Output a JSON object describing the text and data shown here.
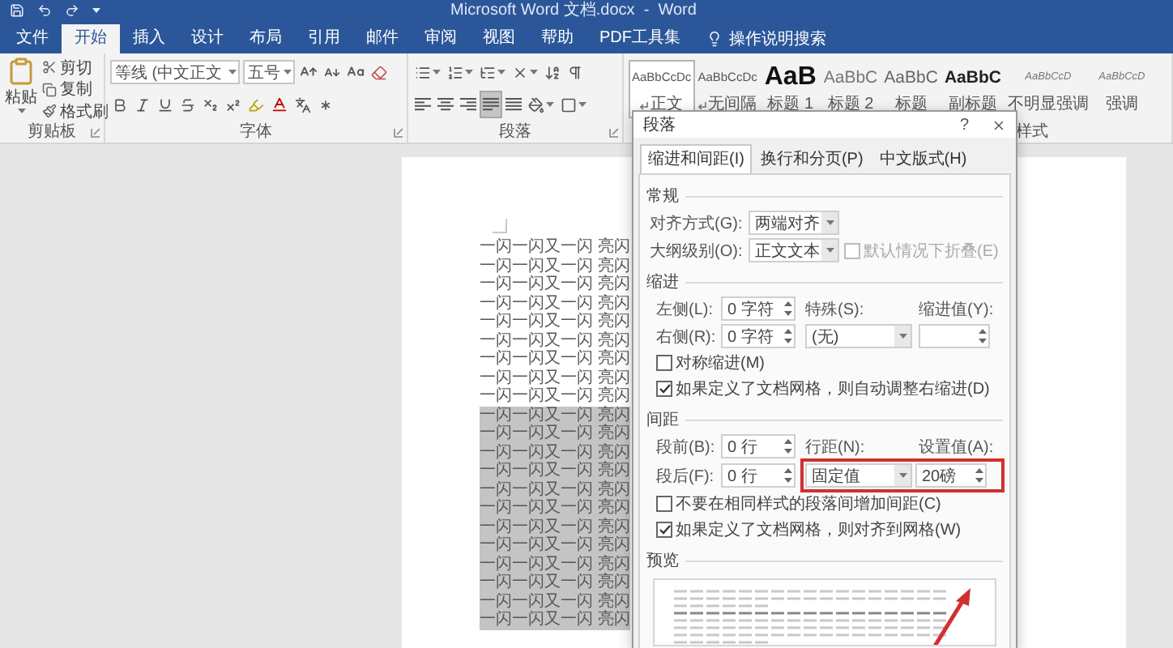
{
  "title_bar": {
    "title": "Microsoft Word 文档.docx  -  Word"
  },
  "ribbon_tabs": [
    {
      "label": "文件",
      "selected": false
    },
    {
      "label": "开始",
      "selected": true
    },
    {
      "label": "插入",
      "selected": false
    },
    {
      "label": "设计",
      "selected": false
    },
    {
      "label": "布局",
      "selected": false
    },
    {
      "label": "引用",
      "selected": false
    },
    {
      "label": "邮件",
      "selected": false
    },
    {
      "label": "审阅",
      "selected": false
    },
    {
      "label": "视图",
      "selected": false
    },
    {
      "label": "帮助",
      "selected": false
    },
    {
      "label": "PDF工具集",
      "selected": false
    }
  ],
  "tell_me": {
    "label": "操作说明搜索"
  },
  "clipboard": {
    "paste_label": "粘贴",
    "items": [
      "剪切",
      "复制",
      "格式刷"
    ],
    "group_label": "剪贴板"
  },
  "font": {
    "font_name": "等线 (中文正文",
    "font_size": "五号",
    "group_label": "字体"
  },
  "paragraph": {
    "group_label": "段落",
    "alignments": [
      {
        "kind": "left",
        "selected": false
      },
      {
        "kind": "center",
        "selected": false
      },
      {
        "kind": "right",
        "selected": false
      },
      {
        "kind": "justify",
        "selected": true
      },
      {
        "kind": "distributed",
        "selected": false
      }
    ]
  },
  "styles": {
    "group_label": "样式",
    "items": [
      {
        "kind": "body",
        "preview": "AaBbCcDc",
        "label": "正文",
        "paragraph_mark": true,
        "selected": true
      },
      {
        "kind": "body",
        "preview": "AaBbCcDc",
        "label": "无间隔",
        "paragraph_mark": true,
        "selected": false
      },
      {
        "kind": "heading1",
        "preview": "AaB",
        "label": "标题 1",
        "paragraph_mark": false,
        "selected": false
      },
      {
        "kind": "heading2",
        "preview": "AaBbC",
        "label": "标题 2",
        "paragraph_mark": false,
        "selected": false
      },
      {
        "kind": "title",
        "preview": "AaBbC",
        "label": "标题",
        "paragraph_mark": false,
        "selected": false
      },
      {
        "kind": "subtitle",
        "preview": "AaBbC",
        "label": "副标题",
        "paragraph_mark": false,
        "selected": false
      },
      {
        "kind": "emphasis",
        "preview": "AaBbCcD",
        "label": "不明显强调",
        "paragraph_mark": false,
        "selected": false
      },
      {
        "kind": "emphasis",
        "preview": "AaBbCcD",
        "label": "强调",
        "paragraph_mark": false,
        "selected": false
      }
    ]
  },
  "document": {
    "lines": [
      {
        "text": "一闪一闪又一闪 亮闪",
        "selected": false
      },
      {
        "text": "一闪一闪又一闪 亮闪",
        "selected": false
      },
      {
        "text": "一闪一闪又一闪 亮闪",
        "selected": false
      },
      {
        "text": "一闪一闪又一闪 亮闪",
        "selected": false
      },
      {
        "text": "一闪一闪又一闪 亮闪",
        "selected": false
      },
      {
        "text": "一闪一闪又一闪 亮闪",
        "selected": false
      },
      {
        "text": "一闪一闪又一闪 亮闪",
        "selected": false
      },
      {
        "text": "一闪一闪又一闪 亮闪",
        "selected": false
      },
      {
        "text": "一闪一闪又一闪 亮闪",
        "selected": false
      },
      {
        "text": "一闪一闪又一闪 亮闪",
        "selected": true
      },
      {
        "text": "一闪一闪又一闪 亮闪",
        "selected": true
      },
      {
        "text": "一闪一闪又一闪 亮闪",
        "selected": true
      },
      {
        "text": "一闪一闪又一闪 亮闪",
        "selected": true
      },
      {
        "text": "一闪一闪又一闪 亮闪",
        "selected": true
      },
      {
        "text": "一闪一闪又一闪 亮闪",
        "selected": true
      },
      {
        "text": "一闪一闪又一闪 亮闪",
        "selected": true
      },
      {
        "text": "一闪一闪又一闪 亮闪",
        "selected": true
      },
      {
        "text": "一闪一闪又一闪 亮闪",
        "selected": true
      },
      {
        "text": "一闪一闪又一闪 亮闪",
        "selected": true
      },
      {
        "text": "一闪一闪又一闪 亮闪",
        "selected": true
      },
      {
        "text": "一闪一闪又一闪 亮闪",
        "selected": true
      }
    ]
  },
  "dialog": {
    "title": "段落",
    "help": "?",
    "tabs": [
      {
        "label": "缩进和间距(I)",
        "selected": true
      },
      {
        "label": "换行和分页(P)",
        "selected": false
      },
      {
        "label": "中文版式(H)",
        "selected": false
      }
    ],
    "general": {
      "heading": "常规",
      "alignment": {
        "label": "对齐方式(G):",
        "value": "两端对齐"
      },
      "outline": {
        "label": "大纲级别(O):",
        "value": "正文文本"
      },
      "collapse": {
        "label": "默认情况下折叠(E)",
        "checked": false,
        "disabled": true
      }
    },
    "indent": {
      "heading": "缩进",
      "left": {
        "label": "左侧(L):",
        "value": "0 字符"
      },
      "right": {
        "label": "右侧(R):",
        "value": "0 字符"
      },
      "special": {
        "label": "特殊(S):",
        "value": "(无)"
      },
      "by": {
        "label": "缩进值(Y):"
      },
      "mirror": {
        "label": "对称缩进(M)",
        "checked": false
      },
      "auto_adjust": {
        "label": "如果定义了文档网格，则自动调整右缩进(D)",
        "checked": true
      }
    },
    "spacing": {
      "heading": "间距",
      "before": {
        "label": "段前(B):",
        "value": "0 行"
      },
      "after": {
        "label": "段后(F):",
        "value": "0 行"
      },
      "line_spacing": {
        "label": "行距(N):",
        "value": "固定值"
      },
      "at": {
        "label": "设置值(A):",
        "value": "20磅"
      },
      "highlighted": true,
      "no_space_same_style": {
        "label": "不要在相同样式的段落间增加间距(C)",
        "checked": false
      },
      "snap_to_grid": {
        "label": "如果定义了文档网格，则对齐到网格(W)",
        "checked": true
      }
    },
    "preview": {
      "heading": "预览"
    }
  }
}
